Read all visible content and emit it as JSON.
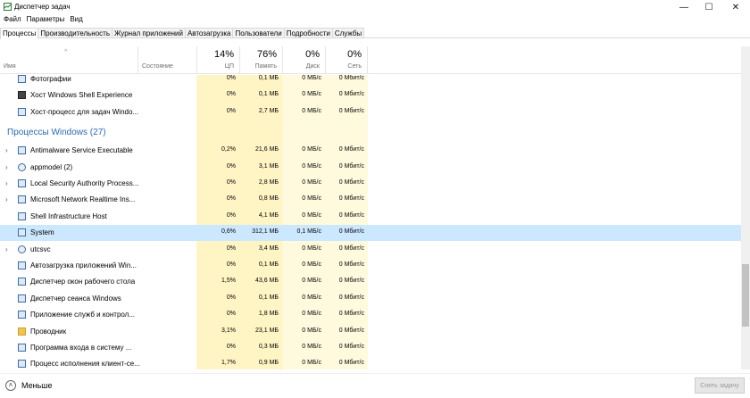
{
  "window": {
    "title": "Диспетчер задач",
    "controls": {
      "minimize": "—",
      "maximize": "☐",
      "close": "✕"
    }
  },
  "menu": [
    "Файл",
    "Параметры",
    "Вид"
  ],
  "tabs": [
    {
      "label": "Процессы",
      "active": true
    },
    {
      "label": "Производительность",
      "active": false
    },
    {
      "label": "Журнал приложений",
      "active": false
    },
    {
      "label": "Автозагрузка",
      "active": false
    },
    {
      "label": "Пользователи",
      "active": false
    },
    {
      "label": "Подробности",
      "active": false
    },
    {
      "label": "Службы",
      "active": false
    }
  ],
  "columns": {
    "name": "Имя",
    "status": "Состояние",
    "cpu": {
      "pct": "14%",
      "label": "ЦП"
    },
    "memory": {
      "pct": "76%",
      "label": "Память"
    },
    "disk": {
      "pct": "0%",
      "label": "Диск"
    },
    "network": {
      "pct": "0%",
      "label": "Сеть"
    }
  },
  "rows_top": [
    {
      "name": "Фотографии",
      "cpu": "0%",
      "mem": "0,1 МБ",
      "disk": "0 МБ/с",
      "net": "0 Мбит/с",
      "icon": "photos-icon",
      "expand": false
    },
    {
      "name": "Хост Windows Shell Experience",
      "cpu": "0%",
      "mem": "0,1 МБ",
      "disk": "0 МБ/с",
      "net": "0 Мбит/с",
      "icon": "shell-experience-icon",
      "expand": false
    },
    {
      "name": "Хост-процесс для задач Windo...",
      "cpu": "0%",
      "mem": "2,7 МБ",
      "disk": "0 МБ/с",
      "net": "0 Мбит/с",
      "icon": "process-icon",
      "expand": false
    }
  ],
  "group": {
    "label": "Процессы Windows (27)"
  },
  "rows_windows": [
    {
      "name": "Antimalware Service Executable",
      "cpu": "0,2%",
      "mem": "21,6 МБ",
      "disk": "0 МБ/с",
      "net": "0 Мбит/с",
      "icon": "process-icon",
      "expand": true
    },
    {
      "name": "appmodel (2)",
      "cpu": "0%",
      "mem": "3,1 МБ",
      "disk": "0 МБ/с",
      "net": "0 Мбит/с",
      "icon": "service-gear-icon",
      "expand": true
    },
    {
      "name": "Local Security Authority Process...",
      "cpu": "0%",
      "mem": "2,8 МБ",
      "disk": "0 МБ/с",
      "net": "0 Мбит/с",
      "icon": "process-icon",
      "expand": true
    },
    {
      "name": "Microsoft Network Realtime Ins...",
      "cpu": "0%",
      "mem": "0,8 МБ",
      "disk": "0 МБ/с",
      "net": "0 Мбит/с",
      "icon": "process-icon",
      "expand": true
    },
    {
      "name": "Shell Infrastructure Host",
      "cpu": "0%",
      "mem": "4,1 МБ",
      "disk": "0 МБ/с",
      "net": "0 Мбит/с",
      "icon": "process-icon",
      "expand": false
    },
    {
      "name": "System",
      "cpu": "0,6%",
      "mem": "312,1 МБ",
      "disk": "0,1 МБ/с",
      "net": "0 Мбит/с",
      "icon": "process-icon",
      "expand": false,
      "selected": true
    },
    {
      "name": "utcsvc",
      "cpu": "0%",
      "mem": "3,4 МБ",
      "disk": "0 МБ/с",
      "net": "0 Мбит/с",
      "icon": "service-gear-icon",
      "expand": true
    },
    {
      "name": "Автозагрузка приложений Win...",
      "cpu": "0%",
      "mem": "0,1 МБ",
      "disk": "0 МБ/с",
      "net": "0 Мбит/с",
      "icon": "process-icon",
      "expand": false
    },
    {
      "name": "Диспетчер окон рабочего стола",
      "cpu": "1,5%",
      "mem": "43,6 МБ",
      "disk": "0 МБ/с",
      "net": "0 Мбит/с",
      "icon": "process-icon",
      "expand": false
    },
    {
      "name": "Диспетчер сеанса Windows",
      "cpu": "0%",
      "mem": "0,1 МБ",
      "disk": "0 МБ/с",
      "net": "0 Мбит/с",
      "icon": "process-icon",
      "expand": false
    },
    {
      "name": "Приложение служб и контрол...",
      "cpu": "0%",
      "mem": "1,8 МБ",
      "disk": "0 МБ/с",
      "net": "0 Мбит/с",
      "icon": "process-icon",
      "expand": false
    },
    {
      "name": "Проводник",
      "cpu": "3,1%",
      "mem": "23,1 МБ",
      "disk": "0 МБ/с",
      "net": "0 Мбит/с",
      "icon": "explorer-folder-icon",
      "expand": false
    },
    {
      "name": "Программа входа в систему ...",
      "cpu": "0%",
      "mem": "0,3 МБ",
      "disk": "0 МБ/с",
      "net": "0 Мбит/с",
      "icon": "process-icon",
      "expand": false
    },
    {
      "name": "Процесс исполнения клиент-се...",
      "cpu": "1,7%",
      "mem": "0,9 МБ",
      "disk": "0 МБ/с",
      "net": "0 Мбит/с",
      "icon": "process-icon",
      "expand": false
    }
  ],
  "footer": {
    "less_label": "Меньше",
    "less_icon": "chevron-up-icon",
    "end_task_label": "Снять задачу"
  }
}
